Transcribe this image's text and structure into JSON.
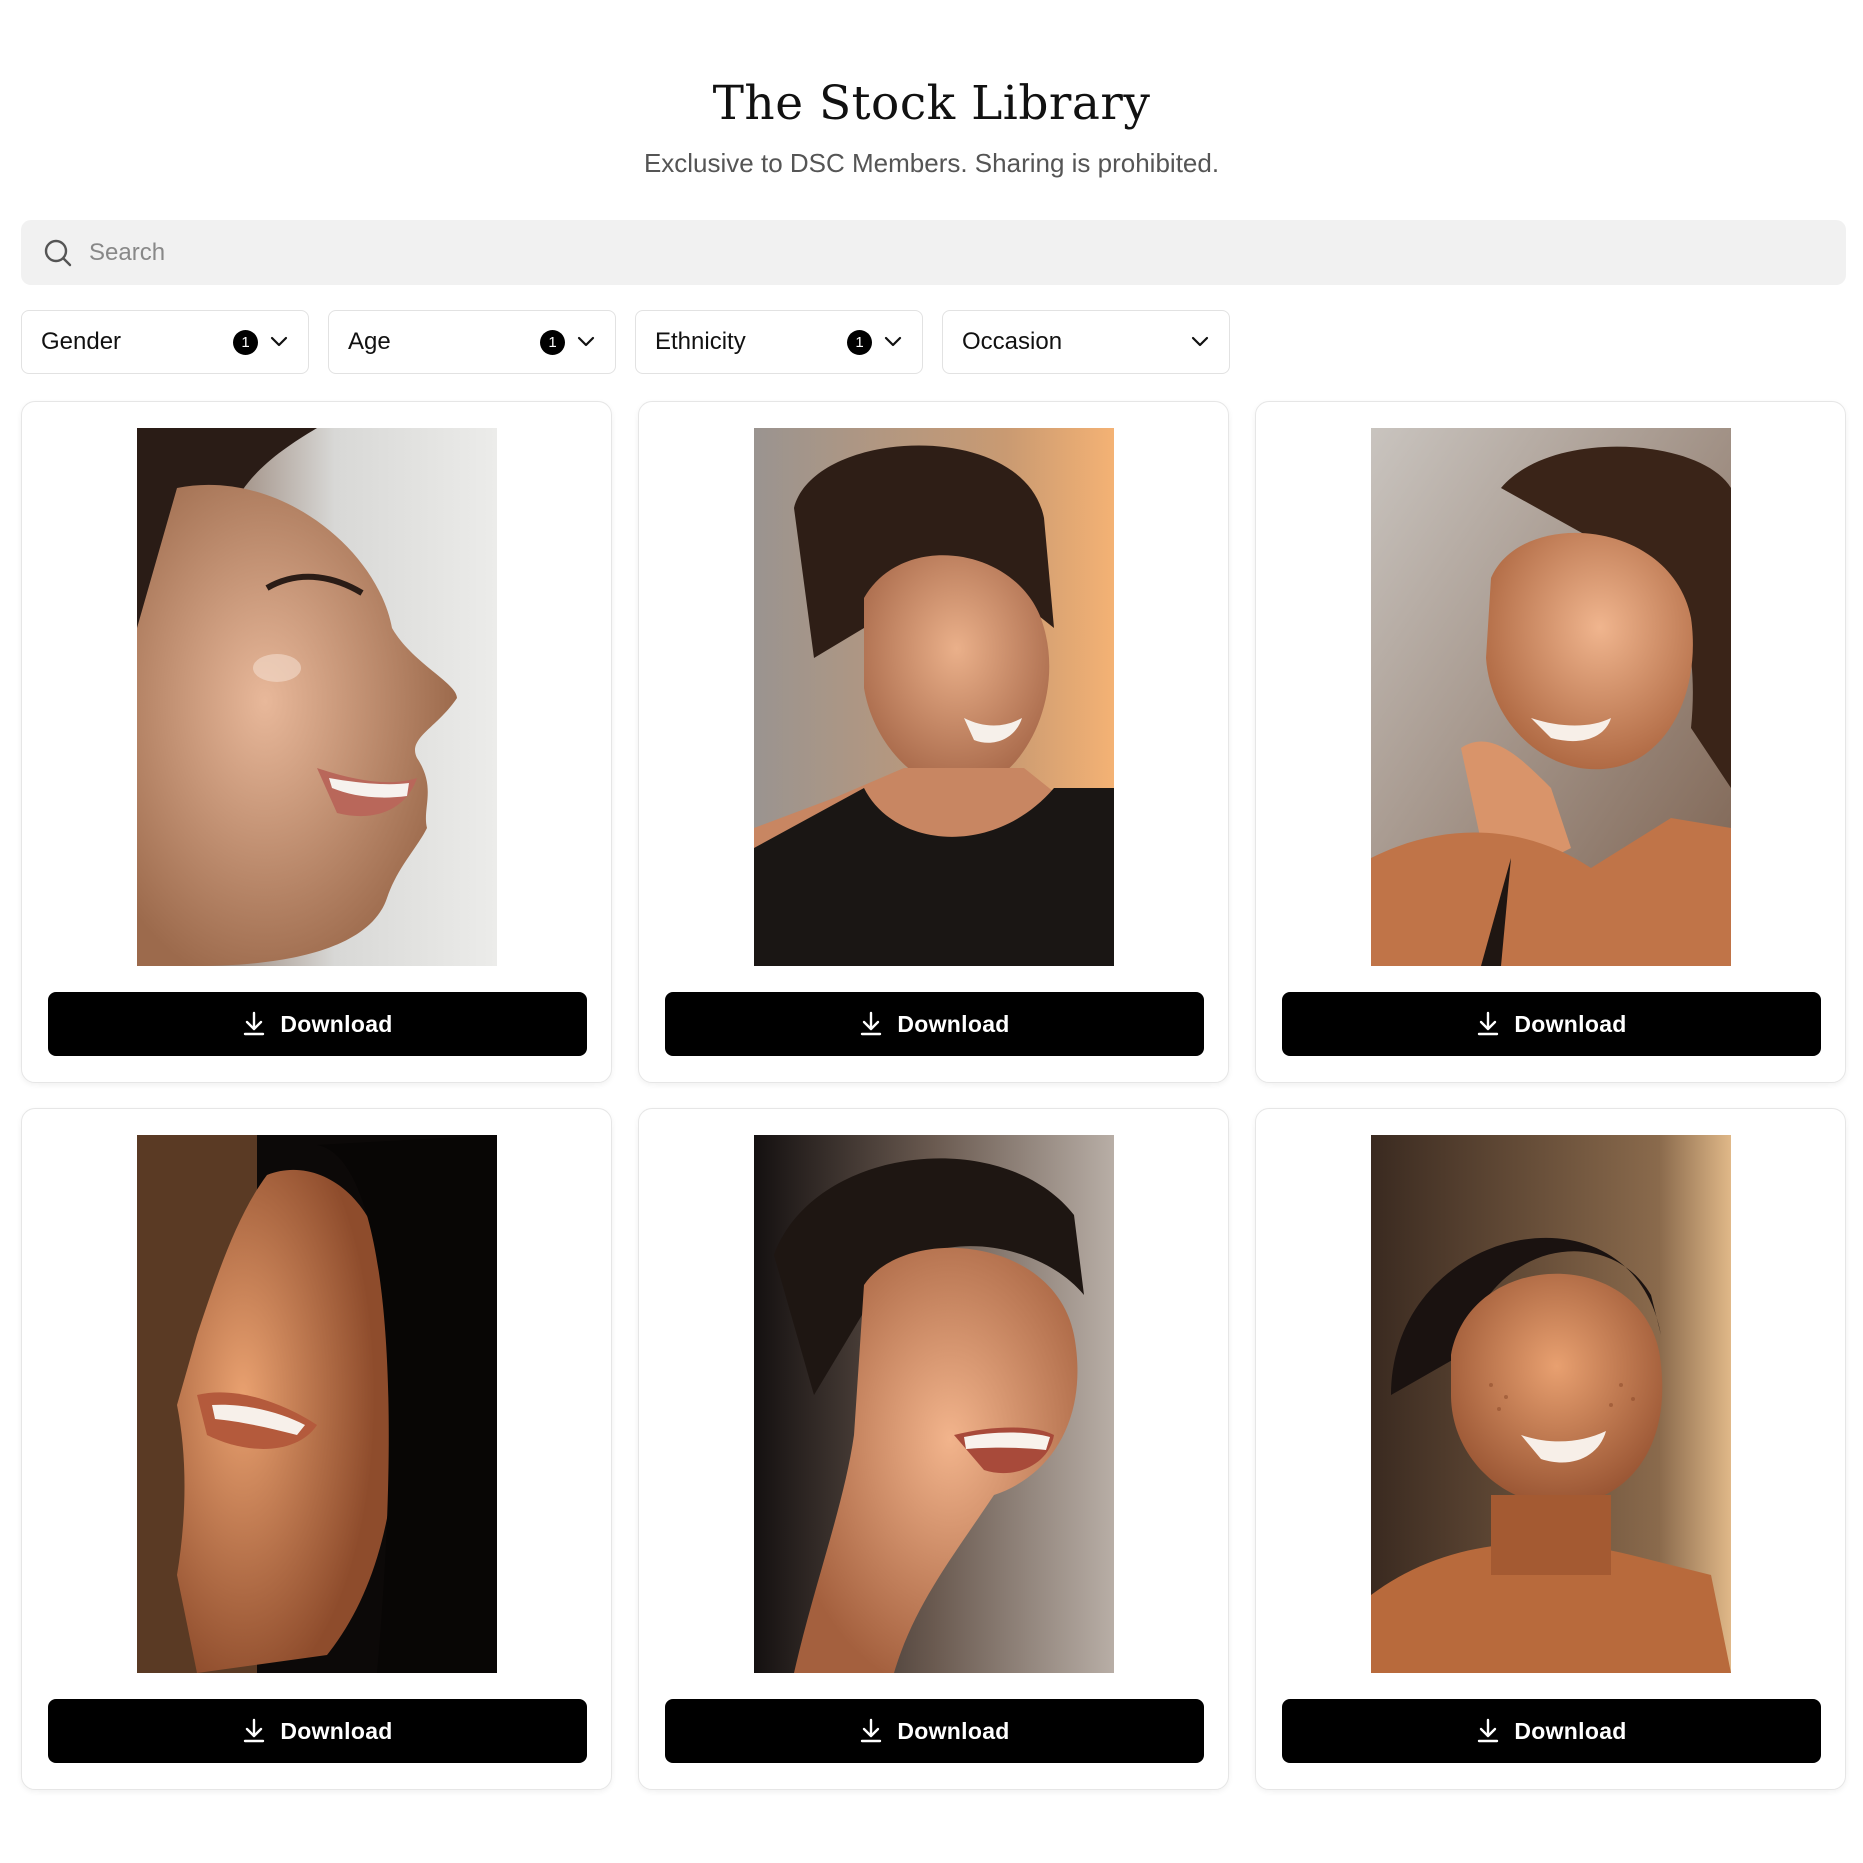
{
  "header": {
    "title": "The Stock Library",
    "subtitle": "Exclusive to DSC Members. Sharing is prohibited."
  },
  "search": {
    "placeholder": "Search",
    "value": "",
    "icon": "search-icon"
  },
  "filters": [
    {
      "label": "Gender",
      "badge": "1",
      "icon": "chevron-down-icon"
    },
    {
      "label": "Age",
      "badge": "1",
      "icon": "chevron-down-icon"
    },
    {
      "label": "Ethnicity",
      "badge": "1",
      "icon": "chevron-down-icon"
    },
    {
      "label": "Occasion",
      "badge": "",
      "icon": "chevron-down-icon"
    }
  ],
  "gallery": {
    "items": [
      {
        "image": "portrait-profile-smiling-woman",
        "download_label": "Download",
        "icon": "download-icon"
      },
      {
        "image": "portrait-smiling-woman-backlit",
        "download_label": "Download",
        "icon": "download-icon"
      },
      {
        "image": "portrait-woman-hand-on-cheek",
        "download_label": "Download",
        "icon": "download-icon"
      },
      {
        "image": "portrait-laughing-woman-shadow",
        "download_label": "Download",
        "icon": "download-icon"
      },
      {
        "image": "portrait-laughing-woman-eyes-closed",
        "download_label": "Download",
        "icon": "download-icon"
      },
      {
        "image": "portrait-freckled-woman-smiling",
        "download_label": "Download",
        "icon": "download-icon"
      }
    ]
  },
  "colors": {
    "button_bg": "#000000",
    "button_text": "#ffffff",
    "search_bg": "#f1f1f1",
    "badge_bg": "#000000"
  }
}
